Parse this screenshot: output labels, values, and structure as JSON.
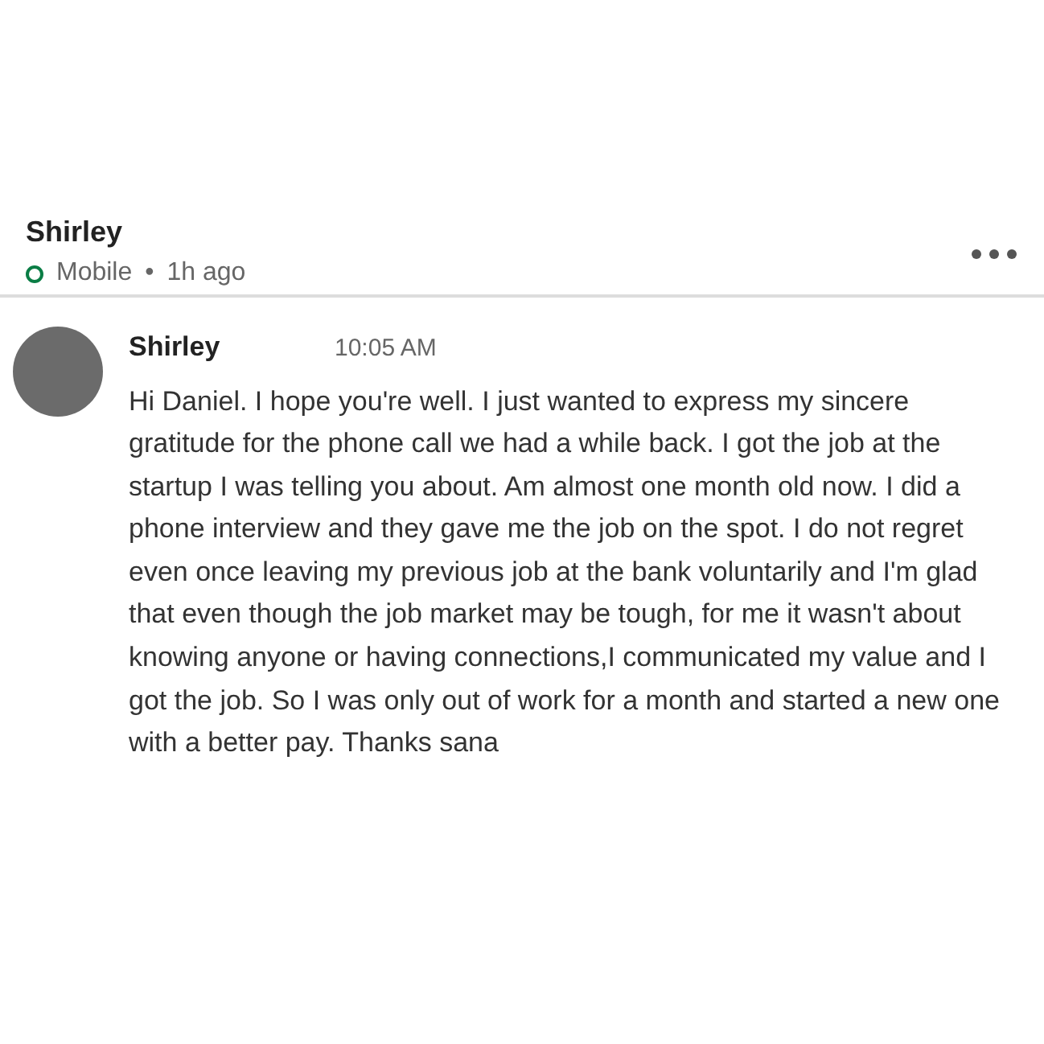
{
  "header": {
    "name": "Shirley",
    "presence": "Mobile",
    "separator": "•",
    "last_seen": "1h ago"
  },
  "messages": [
    {
      "sender": "Shirley",
      "time": "10:05 AM",
      "text": "Hi Daniel. I hope you're well. I just wanted to express my sincere gratitude for the phone call we had a while back. I got the job at the startup I was telling you about. Am almost one month old now. I did a phone interview and they gave me the job on the spot. I do not regret even once leaving my previous job at the bank voluntarily and I'm glad that even though the job market may be tough, for me it wasn't about knowing anyone or having connections,I communicated my value and I got the job. So I was only out of work for a month and started a new one with a better pay. Thanks sana"
    }
  ]
}
